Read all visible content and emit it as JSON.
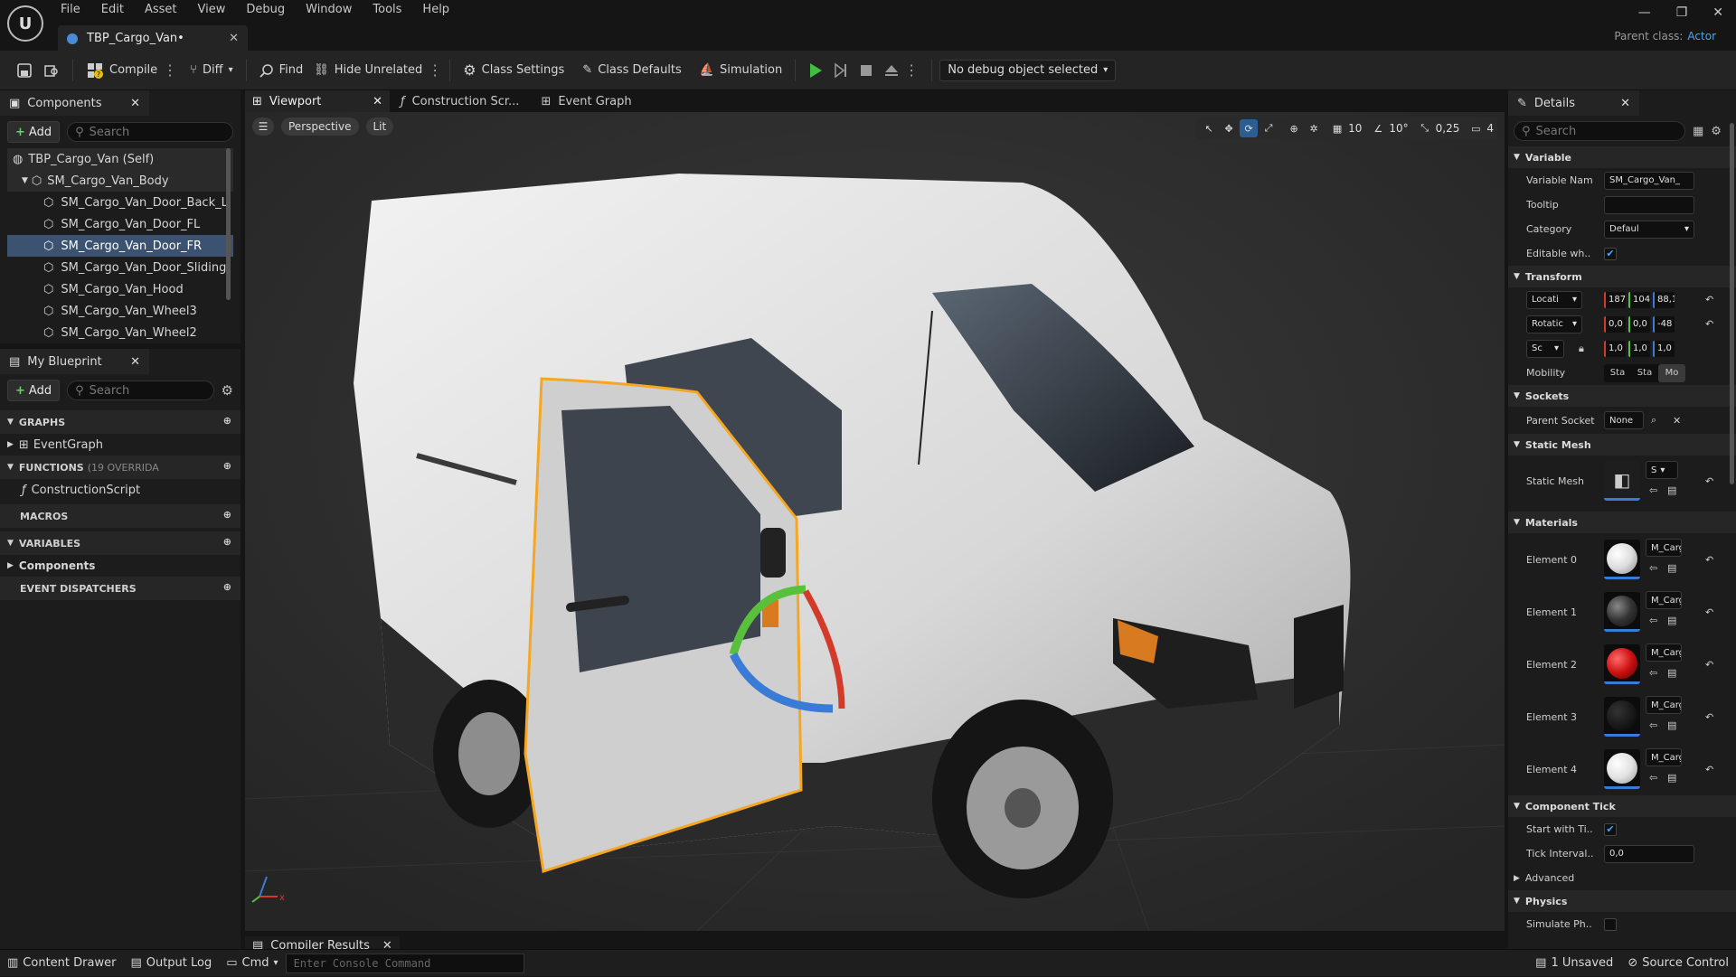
{
  "titlebar": {
    "menu": [
      "File",
      "Edit",
      "Asset",
      "View",
      "Debug",
      "Window",
      "Tools",
      "Help"
    ],
    "tab_title": "TBP_Cargo_Van•",
    "parent_class_label": "Parent class:",
    "parent_class_value": "Actor"
  },
  "toolbar": {
    "compile": "Compile",
    "diff": "Diff",
    "find": "Find",
    "hide_unrelated": "Hide Unrelated",
    "class_settings": "Class Settings",
    "class_defaults": "Class Defaults",
    "simulation": "Simulation",
    "debug_object": "No debug object selected"
  },
  "components": {
    "tab": "Components",
    "add": "Add",
    "search_placeholder": "Search",
    "items": [
      {
        "label": "TBP_Cargo_Van (Self)"
      },
      {
        "label": "SM_Cargo_Van_Body"
      },
      {
        "label": "SM_Cargo_Van_Door_Back_L"
      },
      {
        "label": "SM_Cargo_Van_Door_FL"
      },
      {
        "label": "SM_Cargo_Van_Door_FR"
      },
      {
        "label": "SM_Cargo_Van_Door_Sliding"
      },
      {
        "label": "SM_Cargo_Van_Hood"
      },
      {
        "label": "SM_Cargo_Van_Wheel3"
      },
      {
        "label": "SM_Cargo_Van_Wheel2"
      }
    ]
  },
  "my_blueprint": {
    "tab": "My Blueprint",
    "add": "Add",
    "search_placeholder": "Search",
    "graphs": "GRAPHS",
    "event_graph": "EventGraph",
    "functions": "FUNCTIONS",
    "functions_count": "(19 OVERRIDA",
    "construction_script": "ConstructionScript",
    "macros": "MACROS",
    "variables": "VARIABLES",
    "components": "Components",
    "event_dispatchers": "EVENT DISPATCHERS"
  },
  "center_tabs": [
    "Viewport",
    "Construction Scr...",
    "Event Graph"
  ],
  "viewport": {
    "perspective": "Perspective",
    "lit": "Lit",
    "grid_snap": "10",
    "rot_snap": "10°",
    "scale_snap": "0,25",
    "camera_speed": "4"
  },
  "details": {
    "tab": "Details",
    "search_placeholder": "Search",
    "variable": {
      "title": "Variable",
      "name_label": "Variable Nam",
      "name_value": "SM_Cargo_Van_",
      "tooltip_label": "Tooltip",
      "tooltip_value": "",
      "category_label": "Category",
      "category_value": "Defaul",
      "editable_label": "Editable wh.."
    },
    "transform": {
      "title": "Transform",
      "location_label": "Locati",
      "location": [
        "187",
        "104",
        "88,1"
      ],
      "rotation_label": "Rotatic",
      "rotation": [
        "0,0",
        "0,0",
        "-48"
      ],
      "scale_label": "Sc",
      "scale": [
        "1,0",
        "1,0",
        "1,0"
      ],
      "mobility_label": "Mobility",
      "mobility": [
        "Sta",
        "Sta",
        "Mo"
      ]
    },
    "sockets": {
      "title": "Sockets",
      "parent_label": "Parent Socket",
      "parent_value": "None"
    },
    "static_mesh": {
      "title": "Static Mesh",
      "label": "Static Mesh",
      "dropdown": "S"
    },
    "materials": {
      "title": "Materials",
      "elements": [
        {
          "label": "Element 0",
          "value": "M_Carg"
        },
        {
          "label": "Element 1",
          "value": "M_Carg"
        },
        {
          "label": "Element 2",
          "value": "M_Carg"
        },
        {
          "label": "Element 3",
          "value": "M_Carg"
        },
        {
          "label": "Element 4",
          "value": "M_Carg"
        }
      ]
    },
    "component_tick": {
      "title": "Component Tick",
      "start_label": "Start with Ti..",
      "interval_label": "Tick Interval..",
      "interval_value": "0,0"
    },
    "advanced": "Advanced",
    "physics": {
      "title": "Physics",
      "simulate_label": "Simulate Ph.."
    }
  },
  "bottom": {
    "compiler_results": "Compiler Results",
    "content_drawer": "Content Drawer",
    "output_log": "Output Log",
    "cmd": "Cmd",
    "console_placeholder": "Enter Console Command",
    "unsaved": "1 Unsaved",
    "source_control": "Source Control"
  },
  "colors": {
    "accent_blue": "#3b5270",
    "selection_outline": "#f5a623",
    "play_green": "#3fbf3f"
  }
}
